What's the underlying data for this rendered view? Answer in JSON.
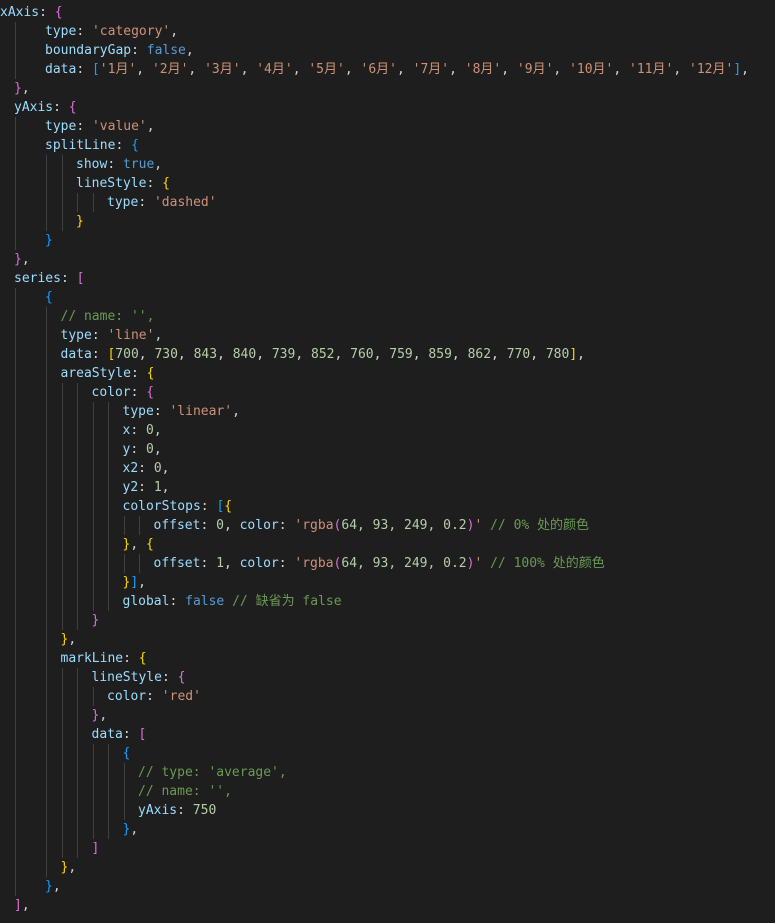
{
  "editor": {
    "lines": [
      {
        "indent": 0,
        "tokens": [
          [
            "key",
            "xAxis"
          ],
          [
            "pun",
            ": "
          ],
          [
            "b2",
            "{"
          ]
        ]
      },
      {
        "indent": 1,
        "tokens": [
          [
            "key",
            "type"
          ],
          [
            "pun",
            ": "
          ],
          [
            "str",
            "'category'"
          ],
          [
            "pun",
            ","
          ]
        ]
      },
      {
        "indent": 1,
        "tokens": [
          [
            "key",
            "boundaryGap"
          ],
          [
            "pun",
            ": "
          ],
          [
            "bool",
            "false"
          ],
          [
            "pun",
            ","
          ]
        ]
      },
      {
        "indent": 1,
        "tokens": [
          [
            "key",
            "data"
          ],
          [
            "pun",
            ": "
          ],
          [
            "b3",
            "["
          ],
          [
            "str",
            "'1月'"
          ],
          [
            "pun",
            ", "
          ],
          [
            "str",
            "'2月'"
          ],
          [
            "pun",
            ", "
          ],
          [
            "str",
            "'3月'"
          ],
          [
            "pun",
            ", "
          ],
          [
            "str",
            "'4月'"
          ],
          [
            "pun",
            ", "
          ],
          [
            "str",
            "'5月'"
          ],
          [
            "pun",
            ", "
          ],
          [
            "str",
            "'6月'"
          ],
          [
            "pun",
            ", "
          ],
          [
            "str",
            "'7月'"
          ],
          [
            "pun",
            ", "
          ],
          [
            "str",
            "'8月'"
          ],
          [
            "pun",
            ", "
          ],
          [
            "str",
            "'9月'"
          ],
          [
            "pun",
            ", "
          ],
          [
            "str",
            "'10月'"
          ],
          [
            "pun",
            ", "
          ],
          [
            "str",
            "'11月'"
          ],
          [
            "pun",
            ", "
          ],
          [
            "str",
            "'12月'"
          ],
          [
            "b3",
            "]"
          ],
          [
            "pun",
            ","
          ]
        ]
      },
      {
        "indent": 0,
        "tokens": [
          [
            "b2",
            "}"
          ],
          [
            "pun",
            ","
          ]
        ]
      },
      {
        "indent": 0,
        "tokens": [
          [
            "key",
            "yAxis"
          ],
          [
            "pun",
            ": "
          ],
          [
            "b2",
            "{"
          ]
        ]
      },
      {
        "indent": 1,
        "tokens": [
          [
            "key",
            "type"
          ],
          [
            "pun",
            ": "
          ],
          [
            "str",
            "'value'"
          ],
          [
            "pun",
            ","
          ]
        ]
      },
      {
        "indent": 1,
        "tokens": [
          [
            "key",
            "splitLine"
          ],
          [
            "pun",
            ": "
          ],
          [
            "b3",
            "{"
          ]
        ]
      },
      {
        "indent": 2,
        "tokens": [
          [
            "key",
            "show"
          ],
          [
            "pun",
            ": "
          ],
          [
            "bool",
            "true"
          ],
          [
            "pun",
            ","
          ]
        ]
      },
      {
        "indent": 2,
        "tokens": [
          [
            "key",
            "lineStyle"
          ],
          [
            "pun",
            ": "
          ],
          [
            "b1",
            "{"
          ]
        ]
      },
      {
        "indent": 3,
        "tokens": [
          [
            "key",
            "type"
          ],
          [
            "pun",
            ": "
          ],
          [
            "str",
            "'dashed'"
          ]
        ]
      },
      {
        "indent": 2,
        "tokens": [
          [
            "b1",
            "}"
          ]
        ]
      },
      {
        "indent": 1,
        "tokens": [
          [
            "b3",
            "}"
          ]
        ]
      },
      {
        "indent": 0,
        "tokens": [
          [
            "b2",
            "}"
          ],
          [
            "pun",
            ","
          ]
        ]
      },
      {
        "indent": 0,
        "tokens": [
          [
            "key",
            "series"
          ],
          [
            "pun",
            ": "
          ],
          [
            "b2",
            "["
          ]
        ]
      },
      {
        "indent": 1,
        "tokens": [
          [
            "b3",
            "{"
          ]
        ]
      },
      {
        "indent": 1.5,
        "tokens": [
          [
            "cmt",
            "// name: '',"
          ]
        ]
      },
      {
        "indent": 1.5,
        "tokens": [
          [
            "key",
            "type"
          ],
          [
            "pun",
            ": "
          ],
          [
            "str",
            "'line'"
          ],
          [
            "pun",
            ","
          ]
        ]
      },
      {
        "indent": 1.5,
        "tokens": [
          [
            "key",
            "data"
          ],
          [
            "pun",
            ": "
          ],
          [
            "b1",
            "["
          ],
          [
            "num",
            "700"
          ],
          [
            "pun",
            ", "
          ],
          [
            "num",
            "730"
          ],
          [
            "pun",
            ", "
          ],
          [
            "num",
            "843"
          ],
          [
            "pun",
            ", "
          ],
          [
            "num",
            "840"
          ],
          [
            "pun",
            ", "
          ],
          [
            "num",
            "739"
          ],
          [
            "pun",
            ", "
          ],
          [
            "num",
            "852"
          ],
          [
            "pun",
            ", "
          ],
          [
            "num",
            "760"
          ],
          [
            "pun",
            ", "
          ],
          [
            "num",
            "759"
          ],
          [
            "pun",
            ", "
          ],
          [
            "num",
            "859"
          ],
          [
            "pun",
            ", "
          ],
          [
            "num",
            "862"
          ],
          [
            "pun",
            ", "
          ],
          [
            "num",
            "770"
          ],
          [
            "pun",
            ", "
          ],
          [
            "num",
            "780"
          ],
          [
            "b1",
            "]"
          ],
          [
            "pun",
            ","
          ]
        ]
      },
      {
        "indent": 1.5,
        "tokens": [
          [
            "key",
            "areaStyle"
          ],
          [
            "pun",
            ": "
          ],
          [
            "b1",
            "{"
          ]
        ]
      },
      {
        "indent": 2.5,
        "tokens": [
          [
            "key",
            "color"
          ],
          [
            "pun",
            ": "
          ],
          [
            "b2",
            "{"
          ]
        ]
      },
      {
        "indent": 3.5,
        "tokens": [
          [
            "key",
            "type"
          ],
          [
            "pun",
            ": "
          ],
          [
            "str",
            "'linear'"
          ],
          [
            "pun",
            ","
          ]
        ]
      },
      {
        "indent": 3.5,
        "tokens": [
          [
            "key",
            "x"
          ],
          [
            "pun",
            ": "
          ],
          [
            "num",
            "0"
          ],
          [
            "pun",
            ","
          ]
        ]
      },
      {
        "indent": 3.5,
        "tokens": [
          [
            "key",
            "y"
          ],
          [
            "pun",
            ": "
          ],
          [
            "num",
            "0"
          ],
          [
            "pun",
            ","
          ]
        ]
      },
      {
        "indent": 3.5,
        "tokens": [
          [
            "key",
            "x2"
          ],
          [
            "pun",
            ": "
          ],
          [
            "num",
            "0"
          ],
          [
            "pun",
            ","
          ]
        ]
      },
      {
        "indent": 3.5,
        "tokens": [
          [
            "key",
            "y2"
          ],
          [
            "pun",
            ": "
          ],
          [
            "num",
            "1"
          ],
          [
            "pun",
            ","
          ]
        ]
      },
      {
        "indent": 3.5,
        "tokens": [
          [
            "key",
            "colorStops"
          ],
          [
            "pun",
            ": "
          ],
          [
            "b3",
            "["
          ],
          [
            "b1",
            "{"
          ]
        ]
      },
      {
        "indent": 4.5,
        "tokens": [
          [
            "key",
            "offset"
          ],
          [
            "pun",
            ": "
          ],
          [
            "num",
            "0"
          ],
          [
            "pun",
            ", "
          ],
          [
            "key",
            "color"
          ],
          [
            "pun",
            ": "
          ],
          [
            "str",
            "'rgba"
          ],
          [
            "b2",
            "("
          ],
          [
            "num",
            "64, 93, 249, 0.2"
          ],
          [
            "b2",
            ")"
          ],
          [
            "str",
            "'"
          ],
          [
            "pun",
            " "
          ],
          [
            "cmt",
            "// 0% 处的颜色"
          ]
        ]
      },
      {
        "indent": 3.5,
        "tokens": [
          [
            "b1",
            "}"
          ],
          [
            "pun",
            ", "
          ],
          [
            "b1",
            "{"
          ]
        ]
      },
      {
        "indent": 4.5,
        "tokens": [
          [
            "key",
            "offset"
          ],
          [
            "pun",
            ": "
          ],
          [
            "num",
            "1"
          ],
          [
            "pun",
            ", "
          ],
          [
            "key",
            "color"
          ],
          [
            "pun",
            ": "
          ],
          [
            "str",
            "'rgba"
          ],
          [
            "b2",
            "("
          ],
          [
            "num",
            "64, 93, 249, 0.2"
          ],
          [
            "b2",
            ")"
          ],
          [
            "str",
            "'"
          ],
          [
            "pun",
            " "
          ],
          [
            "cmt",
            "// 100% 处的颜色"
          ]
        ]
      },
      {
        "indent": 3.5,
        "tokens": [
          [
            "b1",
            "}"
          ],
          [
            "b3",
            "]"
          ],
          [
            "pun",
            ","
          ]
        ]
      },
      {
        "indent": 3.5,
        "tokens": [
          [
            "key",
            "global"
          ],
          [
            "pun",
            ": "
          ],
          [
            "bool",
            "false"
          ],
          [
            "pun",
            " "
          ],
          [
            "cmt",
            "// 缺省为 false"
          ]
        ]
      },
      {
        "indent": 2.5,
        "tokens": [
          [
            "b2",
            "}"
          ]
        ]
      },
      {
        "indent": 1.5,
        "tokens": [
          [
            "b1",
            "}"
          ],
          [
            "pun",
            ","
          ]
        ]
      },
      {
        "indent": 1.5,
        "tokens": [
          [
            "key",
            "markLine"
          ],
          [
            "pun",
            ": "
          ],
          [
            "b1",
            "{"
          ]
        ]
      },
      {
        "indent": 2.5,
        "tokens": [
          [
            "key",
            "lineStyle"
          ],
          [
            "pun",
            ": "
          ],
          [
            "b2",
            "{"
          ]
        ]
      },
      {
        "indent": 3.0,
        "tokens": [
          [
            "key",
            "color"
          ],
          [
            "pun",
            ": "
          ],
          [
            "str",
            "'red'"
          ]
        ]
      },
      {
        "indent": 2.5,
        "tokens": [
          [
            "b2",
            "}"
          ],
          [
            "pun",
            ","
          ]
        ]
      },
      {
        "indent": 2.5,
        "tokens": [
          [
            "key",
            "data"
          ],
          [
            "pun",
            ": "
          ],
          [
            "b2",
            "["
          ]
        ]
      },
      {
        "indent": 3.5,
        "tokens": [
          [
            "b3",
            "{"
          ]
        ]
      },
      {
        "indent": 4.0,
        "tokens": [
          [
            "cmt",
            "// type: 'average',"
          ]
        ]
      },
      {
        "indent": 4.0,
        "tokens": [
          [
            "cmt",
            "// name: '',"
          ]
        ]
      },
      {
        "indent": 4.0,
        "tokens": [
          [
            "key",
            "yAxis"
          ],
          [
            "pun",
            ": "
          ],
          [
            "num",
            "750"
          ]
        ]
      },
      {
        "indent": 3.5,
        "tokens": [
          [
            "b3",
            "}"
          ],
          [
            "pun",
            ","
          ]
        ]
      },
      {
        "indent": 2.5,
        "tokens": [
          [
            "b2",
            "]"
          ]
        ]
      },
      {
        "indent": 1.5,
        "tokens": [
          [
            "b1",
            "}"
          ],
          [
            "pun",
            ","
          ]
        ]
      },
      {
        "indent": 1,
        "tokens": [
          [
            "b3",
            "}"
          ],
          [
            "pun",
            ","
          ]
        ]
      },
      {
        "indent": 0,
        "tokens": [
          [
            "b2",
            "]"
          ],
          [
            "pun",
            ","
          ]
        ]
      }
    ]
  }
}
